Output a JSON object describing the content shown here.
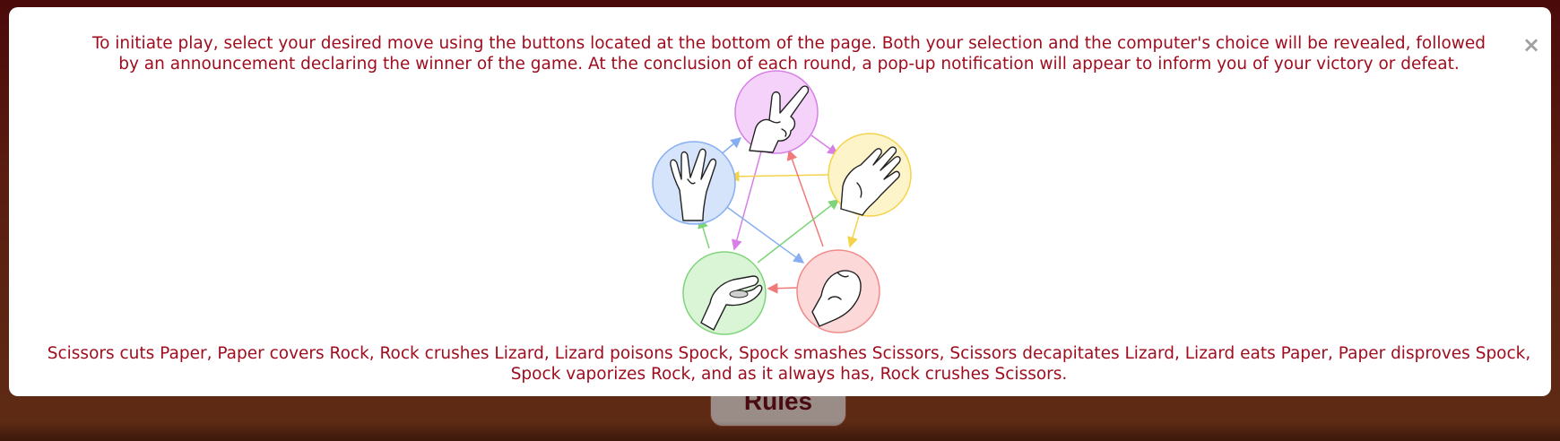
{
  "background_button": {
    "label": "Rules"
  },
  "modal": {
    "close_label": "×",
    "intro": "To initiate play, select your desired move using the buttons located at the bottom of the page. Both your selection and the computer's choice will be revealed, followed by an announcement declaring the winner of the game. At the conclusion of each round, a pop-up notification will appear to inform you of your victory or defeat.",
    "rules_summary": "Scissors cuts Paper, Paper covers Rock, Rock crushes Lizard, Lizard poisons Spock, Spock smashes Scissors, Scissors decapitates Lizard, Lizard eats Paper, Paper disproves Spock, Spock vaporizes Rock, and as it always has, Rock crushes Scissors."
  },
  "diagram": {
    "moves": [
      {
        "name": "scissors",
        "icon": "scissors-hand-icon",
        "fill": "#f4d2f9",
        "stroke": "#d77fe6"
      },
      {
        "name": "paper",
        "icon": "paper-hand-icon",
        "fill": "#fdf4c9",
        "stroke": "#f5d34a"
      },
      {
        "name": "rock",
        "icon": "rock-hand-icon",
        "fill": "#fdd8d8",
        "stroke": "#f08a8a"
      },
      {
        "name": "lizard",
        "icon": "lizard-hand-icon",
        "fill": "#d9f5d6",
        "stroke": "#7fd47a"
      },
      {
        "name": "spock",
        "icon": "spock-hand-icon",
        "fill": "#d6e4fb",
        "stroke": "#86aef0"
      }
    ],
    "arrow_colors": {
      "scissors": "#d77fe6",
      "paper": "#f5d34a",
      "rock": "#f07a7a",
      "lizard": "#7fd47a",
      "spock": "#86aef0"
    }
  }
}
